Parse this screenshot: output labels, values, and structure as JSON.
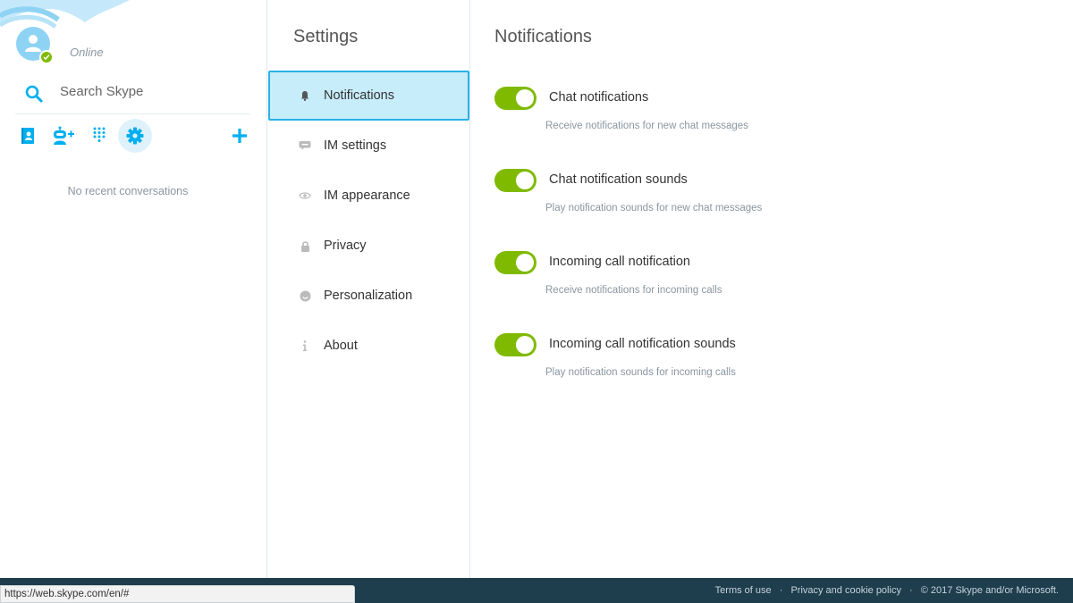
{
  "sidebar": {
    "status": "Online",
    "search_placeholder": "Search Skype",
    "toolbar": [
      {
        "icon": "contacts-icon",
        "label": "Contacts"
      },
      {
        "icon": "add-bot-icon",
        "label": "Add bot"
      },
      {
        "icon": "dialpad-icon",
        "label": "Dial pad"
      },
      {
        "icon": "gear-icon",
        "label": "Settings",
        "active": true
      }
    ],
    "add_icon": "plus-icon",
    "empty_text": "No recent conversations"
  },
  "settings_nav": {
    "title": "Settings",
    "items": [
      {
        "label": "Notifications",
        "icon": "bell-icon",
        "active": true
      },
      {
        "label": "IM settings",
        "icon": "chat-bubble-icon"
      },
      {
        "label": "IM appearance",
        "icon": "eye-icon"
      },
      {
        "label": "Privacy",
        "icon": "lock-icon"
      },
      {
        "label": "Personalization",
        "icon": "smiley-icon"
      },
      {
        "label": "About",
        "icon": "info-icon"
      }
    ]
  },
  "main": {
    "title": "Notifications",
    "settings": [
      {
        "label": "Chat notifications",
        "desc": "Receive notifications for new chat messages",
        "enabled": true
      },
      {
        "label": "Chat notification sounds",
        "desc": "Play notification sounds for new chat messages",
        "enabled": true
      },
      {
        "label": "Incoming call notification",
        "desc": "Receive notifications for incoming calls",
        "enabled": true
      },
      {
        "label": "Incoming call notification sounds",
        "desc": "Play notification sounds for incoming calls",
        "enabled": true
      }
    ]
  },
  "footer": {
    "terms": "Terms of use",
    "privacy": "Privacy and cookie policy",
    "separator": "·",
    "copyright": "© 2017 Skype and/or Microsoft."
  },
  "status_bar": {
    "url": "https://web.skype.com/en/#"
  },
  "colors": {
    "accent": "#00aff0",
    "toggle_on": "#7fba00",
    "footer_bg": "#1e3d4d",
    "nav_active_bg": "#c7ecfa",
    "nav_active_border": "#2ab1e8"
  }
}
